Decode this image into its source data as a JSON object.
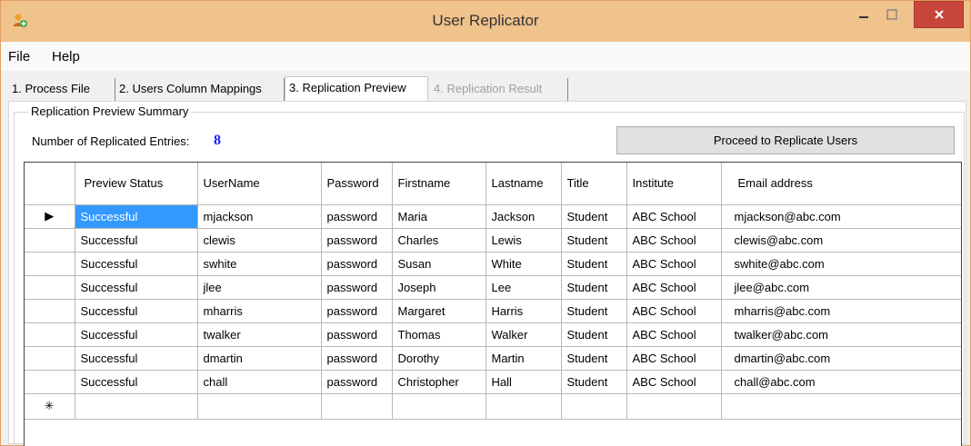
{
  "window": {
    "title": "User Replicator",
    "colors": {
      "titlebar": "#f0c28c",
      "close": "#c7453b",
      "accent": "#1a1aff",
      "selection": "#3399ff"
    }
  },
  "menu": {
    "items": [
      "File",
      "Help"
    ]
  },
  "tabs": [
    {
      "label": "1. Process File",
      "state": "normal"
    },
    {
      "label": "2. Users Column Mappings",
      "state": "normal"
    },
    {
      "label": "3. Replication Preview",
      "state": "active"
    },
    {
      "label": "4. Replication Result",
      "state": "disabled"
    }
  ],
  "summary": {
    "group_label": "Replication Preview Summary",
    "count_label": "Number of Replicated Entries:",
    "count_value": "8",
    "proceed_label": "Proceed to Replicate Users"
  },
  "grid": {
    "columns": [
      "Preview Status",
      "UserName",
      "Password",
      "Firstname",
      "Lastname",
      "Title",
      "Institute",
      "Email address"
    ],
    "rows": [
      [
        "Successful",
        "mjackson",
        "password",
        "Maria",
        "Jackson",
        "Student",
        "ABC School",
        "mjackson@abc.com"
      ],
      [
        "Successful",
        "clewis",
        "password",
        "Charles",
        "Lewis",
        "Student",
        "ABC School",
        "clewis@abc.com"
      ],
      [
        "Successful",
        "swhite",
        "password",
        "Susan",
        "White",
        "Student",
        "ABC School",
        "swhite@abc.com"
      ],
      [
        "Successful",
        "jlee",
        "password",
        "Joseph",
        "Lee",
        "Student",
        "ABC School",
        "jlee@abc.com"
      ],
      [
        "Successful",
        "mharris",
        "password",
        "Margaret",
        "Harris",
        "Student",
        "ABC School",
        "mharris@abc.com"
      ],
      [
        "Successful",
        "twalker",
        "password",
        "Thomas",
        "Walker",
        "Student",
        "ABC School",
        "twalker@abc.com"
      ],
      [
        "Successful",
        "dmartin",
        "password",
        "Dorothy",
        "Martin",
        "Student",
        "ABC School",
        "dmartin@abc.com"
      ],
      [
        "Successful",
        "chall",
        "password",
        "Christopher",
        "Hall",
        "Student",
        "ABC School",
        "chall@abc.com"
      ]
    ],
    "current_row_marker": "▶",
    "new_row_marker": "✳"
  }
}
